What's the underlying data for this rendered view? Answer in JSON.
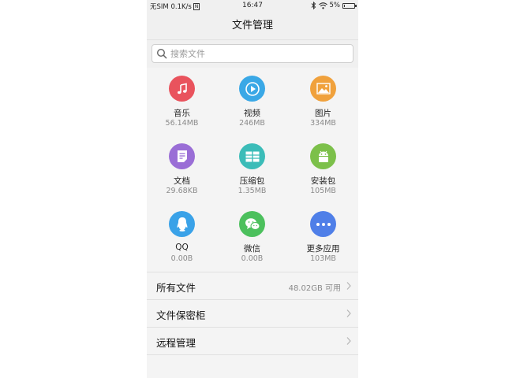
{
  "status_bar": {
    "carrier": "无SIM",
    "speed": "0.1K/s",
    "carrier_box": "N",
    "time": "16:47",
    "battery": "5%",
    "battery_level": 0.05
  },
  "title": "文件管理",
  "search": {
    "placeholder": "搜索文件"
  },
  "categories": [
    {
      "name": "音乐",
      "size": "56.14MB",
      "color": "#e9535d",
      "icon": "music-note-icon"
    },
    {
      "name": "视频",
      "size": "246MB",
      "color": "#3aa8e6",
      "icon": "play-icon"
    },
    {
      "name": "图片",
      "size": "334MB",
      "color": "#f0a13c",
      "icon": "picture-icon"
    },
    {
      "name": "文档",
      "size": "29.68KB",
      "color": "#9a6ed6",
      "icon": "document-icon"
    },
    {
      "name": "压缩包",
      "size": "1.35MB",
      "color": "#3bbcb8",
      "icon": "archive-icon"
    },
    {
      "name": "安装包",
      "size": "105MB",
      "color": "#7cc04a",
      "icon": "android-icon"
    },
    {
      "name": "QQ",
      "size": "0.00B",
      "color": "#3aa2e8",
      "icon": "qq-penguin-icon"
    },
    {
      "name": "微信",
      "size": "0.00B",
      "color": "#4cc05d",
      "icon": "wechat-icon"
    },
    {
      "name": "更多应用",
      "size": "103MB",
      "color": "#4f7fe8",
      "icon": "more-icon"
    }
  ],
  "list": [
    {
      "label": "所有文件",
      "value": "48.02GB 可用"
    },
    {
      "label": "文件保密柜",
      "value": ""
    },
    {
      "label": "远程管理",
      "value": ""
    }
  ]
}
